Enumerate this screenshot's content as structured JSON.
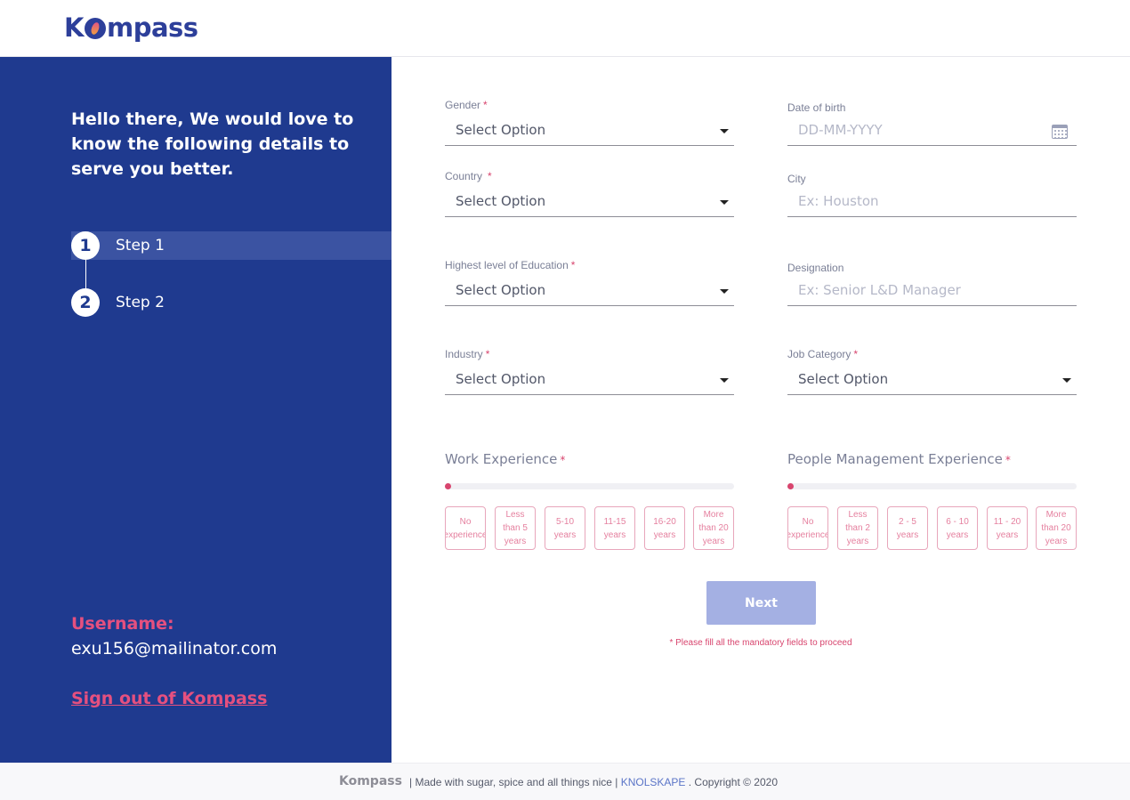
{
  "header": {
    "logo_text": "Kompass"
  },
  "sidebar": {
    "intro": "Hello there, We would love to know the following details to serve you better.",
    "steps": [
      {
        "number": "1",
        "label": "Step 1",
        "active": true
      },
      {
        "number": "2",
        "label": "Step 2",
        "active": false
      }
    ],
    "username_label": "Username:",
    "username": "exu156@mailinator.com",
    "signout": "Sign out of Kompass"
  },
  "form": {
    "required_mark": "*",
    "gender": {
      "label": "Gender",
      "value": "Select Option",
      "required": true
    },
    "dob": {
      "label": "Date of birth",
      "placeholder": "DD-MM-YYYY",
      "icon": "calendar-icon"
    },
    "country": {
      "label": "Country",
      "value": "Select Option",
      "required": true
    },
    "city": {
      "label": "City",
      "placeholder": "Ex: Houston"
    },
    "education": {
      "label": "Highest level of Education",
      "value": "Select Option",
      "required": true
    },
    "designation": {
      "label": "Designation",
      "placeholder": "Ex: Senior L&D Manager"
    },
    "industry": {
      "label": "Industry",
      "value": "Select Option",
      "required": true
    },
    "job_category": {
      "label": "Job Category",
      "value": "Select Option",
      "required": true
    },
    "work_experience": {
      "label": "Work Experience",
      "options": [
        "No experience",
        "Less than 5 years",
        "5-10 years",
        "11-15 years",
        "16-20 years",
        "More than 20 years"
      ],
      "level": 0
    },
    "people_experience": {
      "label": "People Management Experience",
      "options": [
        "No experience",
        "Less than 2 years",
        "2 - 5 years",
        "6 - 10 years",
        "11 - 20 years",
        "More than 20 years"
      ],
      "level": 0
    },
    "next_button": "Next",
    "warning": "* Please fill all the mandatory fields to proceed"
  },
  "footer": {
    "logo": "Kompass",
    "text_before": "| Made with sugar, spice and all things nice |",
    "link": "KNOLSKAPE",
    "text_after": ". Copyright © 2020"
  },
  "colors": {
    "brand": "#1f3a8f",
    "accent": "#d8456e",
    "button": "#a4b0e3"
  }
}
